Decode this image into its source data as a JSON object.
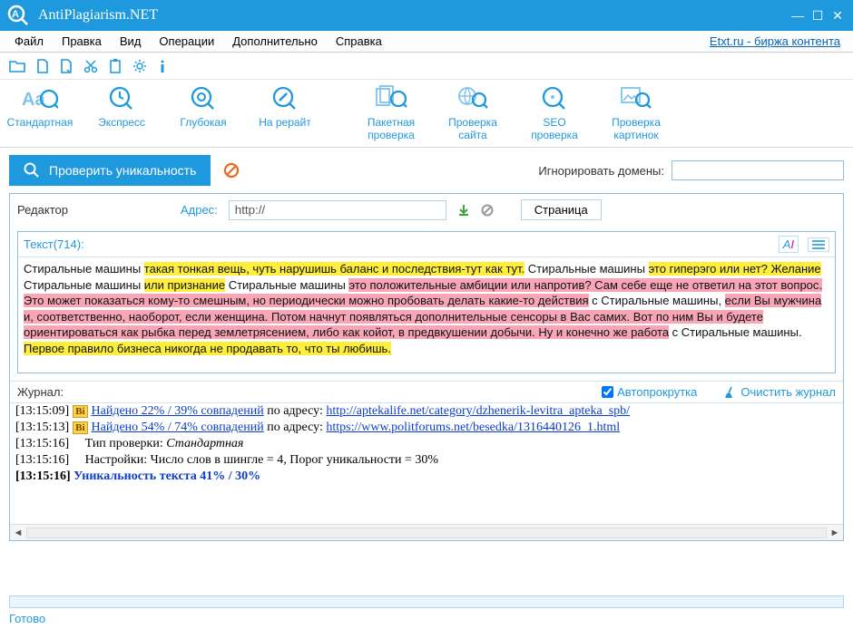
{
  "window": {
    "title": "AntiPlagiarism.NET"
  },
  "menu": {
    "items": [
      "Файл",
      "Правка",
      "Вид",
      "Операции",
      "Дополнительно",
      "Справка"
    ],
    "ext_link": "Etxt.ru - биржа контента"
  },
  "ribbon": {
    "left": [
      "Стандартная",
      "Экспресс",
      "Глубокая",
      "На рерайт"
    ],
    "right": [
      "Пакетная проверка",
      "Проверка сайта",
      "SEO проверка",
      "Проверка картинок"
    ]
  },
  "action": {
    "check_btn": "Проверить уникальность",
    "ignore_label": "Игнорировать домены:",
    "ignore_value": ""
  },
  "editor": {
    "label": "Редактор",
    "addr_label": "Адрес:",
    "addr_value": "http://",
    "page_tab": "Страница",
    "text_count_label": "Текст(714):",
    "text_plain_1": "Стиральные машины ",
    "text_hy_1": "такая тонкая вещь, чуть нарушишь баланс и последствия-тут как тут.",
    "text_plain_2": " Стиральные машины ",
    "text_hy_2": "это гиперэго или нет? Желание",
    "text_plain_3": " Стиральные машины ",
    "text_hy_3": "или признание",
    "text_plain_4": " Стиральные машины ",
    "text_hp_1": "это положительные амбиции или напротив? Сам себе еще не ответил на этот вопрос. Это может показаться кому-то смешным, но периодически можно пробовать делать какие-то действия",
    "text_plain_5": " с Стиральные машины, ",
    "text_hp_2": "если Вы мужчина и, соответственно, наоборот, если женщина. Потом начнут появляться дополнительные сенсоры в Вас самих. Вот по ним Вы и будете ориентироваться как рыбка перед землетрясением, либо как койот, в предвкушении добычи. Ну и конечно же работа",
    "text_plain_6": " с Стиральные машины. ",
    "text_hy_4": "Первое правило бизнеса никогда не продавать то, что ты любишь."
  },
  "journal": {
    "label": "Журнал:",
    "autoscroll": "Автопрокрутка",
    "clear": "Очистить журнал",
    "rows": [
      {
        "ts": "[13:15:09]",
        "badge": "Bi",
        "match": "Найдено 22% / 39% совпадений",
        "mid": " по адресу: ",
        "url": "http://aptekalife.net/category/dzhenerik-levitra_apteka_spb/"
      },
      {
        "ts": "[13:15:13]",
        "badge": "Bi",
        "match": "Найдено 54% / 74% совпадений",
        "mid": " по адресу: ",
        "url": "https://www.politforums.net/besedka/1316440126_1.html"
      },
      {
        "ts": "[13:15:16]",
        "plain_a": "Тип проверки: ",
        "ital": "Стандартная"
      },
      {
        "ts": "[13:15:16]",
        "plain_a": "Настройки: Число слов в шингле = 4, Порог уникальности = 30%"
      },
      {
        "ts": "[13:15:16]",
        "bold_link": "Уникальность текста 41% / 30%"
      }
    ]
  },
  "status": {
    "text": "Готово"
  }
}
